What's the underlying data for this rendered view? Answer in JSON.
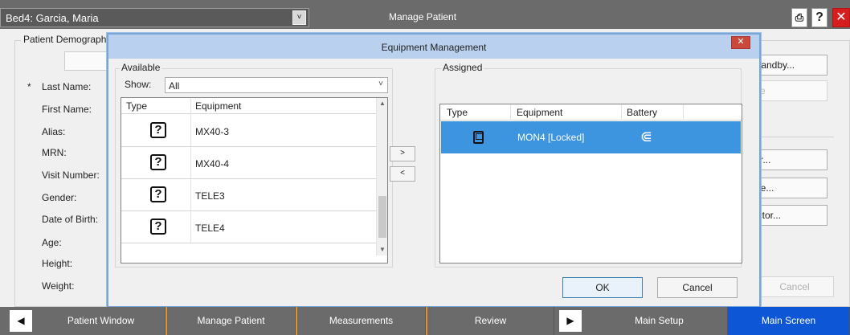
{
  "titlebar": {
    "bed": "Bed4: Garcia, Maria",
    "dropdown_glyph": "˅",
    "app_title": "Manage Patient",
    "print_glyph": "⎙",
    "help_glyph": "?",
    "close_glyph": "✕"
  },
  "background": {
    "group_label": "Patient Demograph",
    "required_mark": "*",
    "fields": [
      "Last Name:",
      "First Name:",
      "Alias:",
      "MRN:",
      "Visit Number:",
      "Gender:",
      "Date of Birth:",
      "Age:",
      "Height:",
      "Weight:"
    ],
    "right_buttons": [
      "Standby...",
      "me",
      "fer...",
      "rge...",
      "ector..."
    ],
    "cancel": "Cancel"
  },
  "dialog": {
    "title": "Equipment Management",
    "close_glyph": "✕",
    "available": {
      "label": "Available",
      "show_label": "Show:",
      "show_value": "All",
      "chevron": "˅",
      "col_type": "Type",
      "col_equipment": "Equipment",
      "icon_glyph": "?",
      "rows": [
        "MX40-3",
        "MX40-4",
        "TELE3",
        "TELE4"
      ]
    },
    "move_right": ">",
    "move_left": "<",
    "assigned": {
      "label": "Assigned",
      "col_type": "Type",
      "col_equipment": "Equipment",
      "col_battery": "Battery",
      "rows": [
        {
          "equipment": "MON4 [Locked]",
          "type_icon": "monitor-icon",
          "battery_icon": "plug-icon"
        }
      ],
      "plug_glyph": "⋐"
    },
    "ok": "OK",
    "cancel": "Cancel"
  },
  "nav": {
    "left_arrow": "◀",
    "right_arrow": "▶",
    "items": [
      "Patient Window",
      "Manage Patient",
      "Measurements",
      "Review",
      "Main Setup",
      "Main Screen"
    ]
  },
  "colors": {
    "titlebar": "#6b6b6b",
    "selection": "#3d95e0",
    "active_nav": "#0d56d6",
    "dialog_border": "#7aa5d6",
    "accent_orange": "#e1922b"
  }
}
